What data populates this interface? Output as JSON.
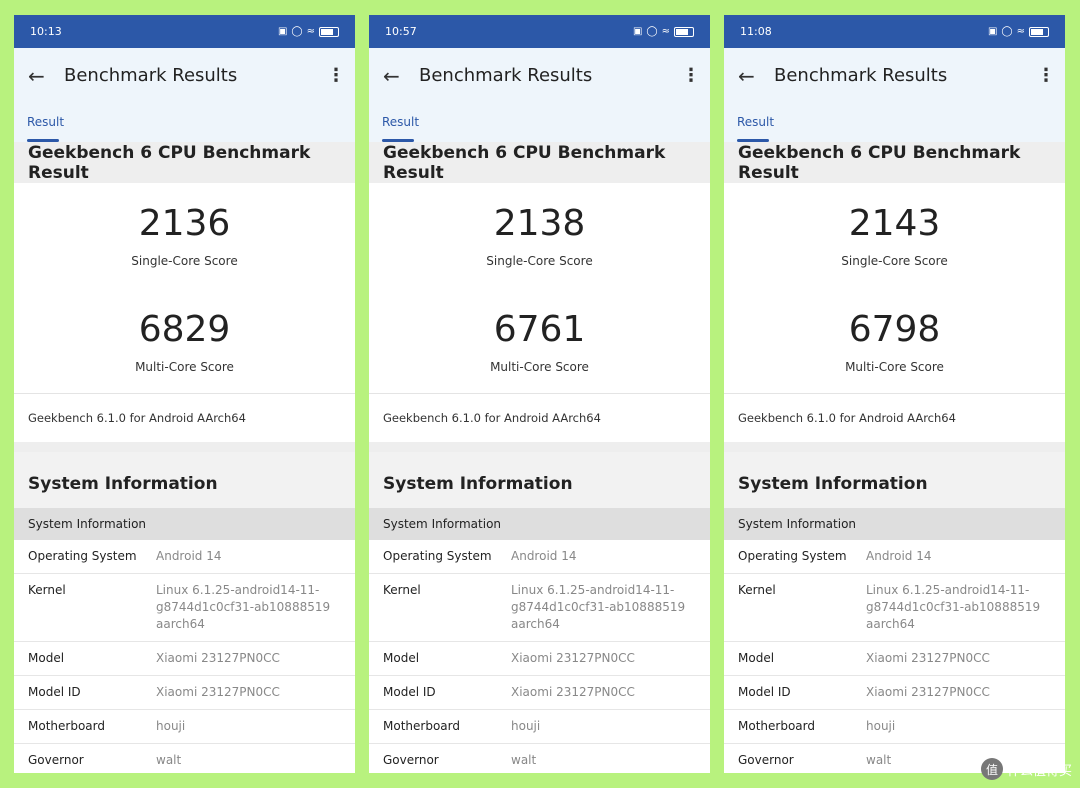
{
  "phones": [
    {
      "time": "10:13",
      "title": "Benchmark Results",
      "tab": "Result",
      "section_title": "Geekbench 6 CPU Benchmark Result",
      "single_score": "2136",
      "single_label": "Single-Core Score",
      "multi_score": "6829",
      "multi_label": "Multi-Core Score",
      "version": "Geekbench 6.1.0 for Android AArch64",
      "sysinfo_title": "System Information",
      "sysinfo_sub": "System Information",
      "rows": [
        {
          "k": "Operating System",
          "v": "Android 14"
        },
        {
          "k": "Kernel",
          "v": "Linux 6.1.25-android14-11-g8744d1c0cf31-ab10888519 aarch64"
        },
        {
          "k": "Model",
          "v": "Xiaomi 23127PN0CC"
        },
        {
          "k": "Model ID",
          "v": "Xiaomi 23127PN0CC"
        },
        {
          "k": "Motherboard",
          "v": "houji"
        },
        {
          "k": "Governor",
          "v": "walt"
        }
      ]
    },
    {
      "time": "10:57",
      "title": "Benchmark Results",
      "tab": "Result",
      "section_title": "Geekbench 6 CPU Benchmark Result",
      "single_score": "2138",
      "single_label": "Single-Core Score",
      "multi_score": "6761",
      "multi_label": "Multi-Core Score",
      "version": "Geekbench 6.1.0 for Android AArch64",
      "sysinfo_title": "System Information",
      "sysinfo_sub": "System Information",
      "rows": [
        {
          "k": "Operating System",
          "v": "Android 14"
        },
        {
          "k": "Kernel",
          "v": "Linux 6.1.25-android14-11-g8744d1c0cf31-ab10888519 aarch64"
        },
        {
          "k": "Model",
          "v": "Xiaomi 23127PN0CC"
        },
        {
          "k": "Model ID",
          "v": "Xiaomi 23127PN0CC"
        },
        {
          "k": "Motherboard",
          "v": "houji"
        },
        {
          "k": "Governor",
          "v": "walt"
        }
      ]
    },
    {
      "time": "11:08",
      "title": "Benchmark Results",
      "tab": "Result",
      "section_title": "Geekbench 6 CPU Benchmark Result",
      "single_score": "2143",
      "single_label": "Single-Core Score",
      "multi_score": "6798",
      "multi_label": "Multi-Core Score",
      "version": "Geekbench 6.1.0 for Android AArch64",
      "sysinfo_title": "System Information",
      "sysinfo_sub": "System Information",
      "rows": [
        {
          "k": "Operating System",
          "v": "Android 14"
        },
        {
          "k": "Kernel",
          "v": "Linux 6.1.25-android14-11-g8744d1c0cf31-ab10888519 aarch64"
        },
        {
          "k": "Model",
          "v": "Xiaomi 23127PN0CC"
        },
        {
          "k": "Model ID",
          "v": "Xiaomi 23127PN0CC"
        },
        {
          "k": "Motherboard",
          "v": "houji"
        },
        {
          "k": "Governor",
          "v": "walt"
        }
      ]
    }
  ],
  "watermark": {
    "badge": "值",
    "text": "什么值得买"
  },
  "colors": {
    "accent": "#2c58a8",
    "background": "#b8f27e"
  }
}
